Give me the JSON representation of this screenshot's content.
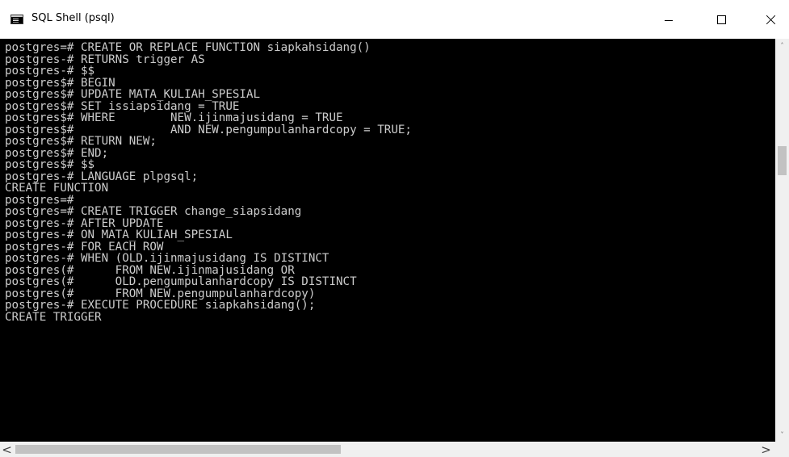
{
  "window": {
    "title": "SQL Shell (psql)",
    "icon": "console-icon",
    "controls": {
      "minimize": "minimize-icon",
      "maximize": "maximize-icon",
      "close": "close-icon"
    }
  },
  "console": {
    "background": "#000000",
    "text_color": "#cccccc",
    "lines": [
      "postgres=# CREATE OR REPLACE FUNCTION siapkahsidang()",
      "postgres-# RETURNS trigger AS",
      "postgres-# $$",
      "postgres$# BEGIN",
      "postgres$# UPDATE MATA_KULIAH_SPESIAL",
      "postgres$# SET issiapsidang = TRUE",
      "postgres$# WHERE        NEW.ijinmajusidang = TRUE",
      "postgres$#              AND NEW.pengumpulanhardcopy = TRUE;",
      "postgres$# RETURN NEW;",
      "postgres$# END;",
      "postgres$# $$",
      "postgres-# LANGUAGE plpgsql;",
      "CREATE FUNCTION",
      "postgres=#",
      "postgres=# CREATE TRIGGER change_siapsidang",
      "postgres-# AFTER UPDATE",
      "postgres-# ON MATA_KULIAH_SPESIAL",
      "postgres-# FOR EACH ROW",
      "postgres-# WHEN (OLD.ijinmajusidang IS DISTINCT",
      "postgres(#      FROM NEW.ijinmajusidang OR",
      "postgres(#      OLD.pengumpulanhardcopy IS DISTINCT",
      "postgres(#      FROM NEW.pengumpulanhardcopy)",
      "postgres-# EXECUTE PROCEDURE siapkahsidang();",
      "CREATE TRIGGER"
    ]
  },
  "scrollbars": {
    "vertical": {
      "up_glyph": "˄",
      "down_glyph": "˅"
    },
    "horizontal": {
      "left_glyph": "<",
      "right_glyph": ">"
    }
  }
}
